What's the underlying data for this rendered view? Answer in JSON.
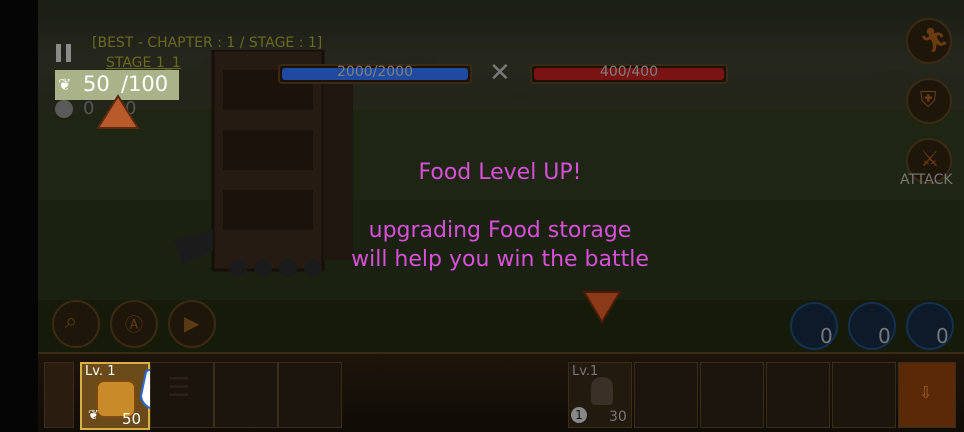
{
  "hud": {
    "best_label": "[BEST - CHAPTER : 1 / STAGE : 1]",
    "stage_label": "STAGE 1_1",
    "food_current": "50",
    "food_max": "/100",
    "units_count": "0",
    "units_count2": "0"
  },
  "health": {
    "player_hp": "2000/2000",
    "enemy_hp": "400/400",
    "player_fill": 1.0,
    "enemy_fill": 1.0
  },
  "right_buttons": {
    "attack_label": "ATTACK"
  },
  "tutorial": {
    "line1": "Food Level UP!",
    "line2": "upgrading Food storage",
    "line3": "will help you win the battle"
  },
  "skills": {
    "counts": [
      "0",
      "0",
      "0"
    ]
  },
  "slots": {
    "food_level": "Lv. 1",
    "food_cost": "50",
    "unit_level": "Lv.1",
    "unit_cost": "30",
    "unit_badge": "1"
  },
  "colors": {
    "tutorial_text": "#d84fd8",
    "player_bar": "#1f4aa0",
    "enemy_bar": "#7a1414",
    "hud_text": "#ffffff"
  }
}
